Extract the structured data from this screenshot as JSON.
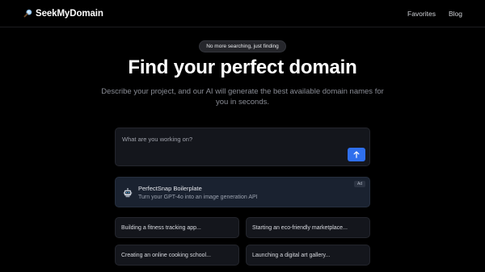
{
  "header": {
    "brand_icon": "magnifier-icon",
    "brand_name": "SeekMyDomain",
    "nav": [
      "Favorites",
      "Blog"
    ]
  },
  "hero": {
    "pill": "No more searching, just finding",
    "title": "Find your perfect domain",
    "subtitle": "Describe your project, and our AI will generate the best available domain names for you in seconds."
  },
  "prompt": {
    "placeholder": "What are you working on?",
    "value": "",
    "submit_icon": "arrow-up-icon"
  },
  "ad": {
    "icon": "robot-icon",
    "title": "PerfectSnap Boilerplate",
    "description": "Turn your GPT-4o into an image generation API",
    "badge": "Ad"
  },
  "suggestions": [
    "Building a fitness tracking app...",
    "Starting an eco-friendly marketplace...",
    "Creating an online cooking school...",
    "Launching a digital art gallery..."
  ],
  "colors": {
    "background": "#000000",
    "accent": "#2f6fed",
    "card": "#14161c",
    "ad_card": "#1a2230",
    "muted_text": "#8a8d96"
  }
}
